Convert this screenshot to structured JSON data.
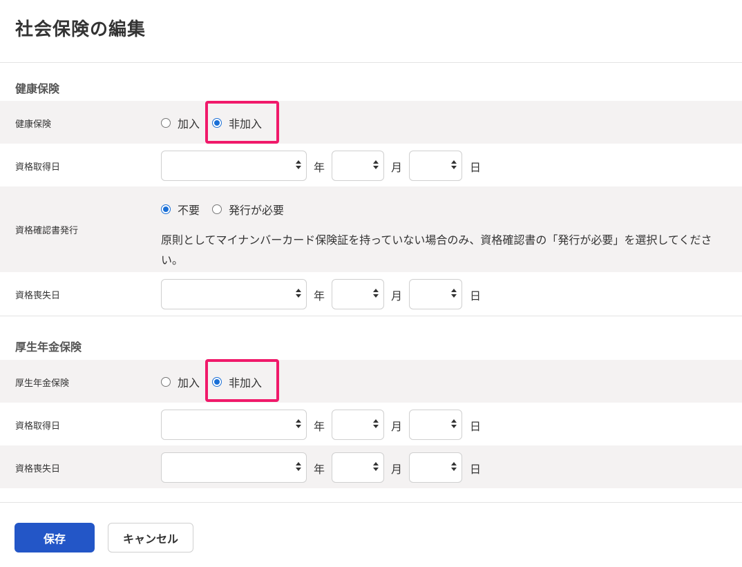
{
  "page": {
    "title": "社会保険の編集"
  },
  "health": {
    "section_title": "健康保険",
    "enrollment": {
      "label": "健康保険",
      "options": [
        {
          "label": "加入",
          "checked": false
        },
        {
          "label": "非加入",
          "checked": true
        }
      ]
    },
    "acquisition_date": {
      "label": "資格取得日",
      "year_unit": "年",
      "month_unit": "月",
      "day_unit": "日"
    },
    "certificate": {
      "label": "資格確認書発行",
      "options": [
        {
          "label": "不要",
          "checked": true
        },
        {
          "label": "発行が必要",
          "checked": false
        }
      ],
      "note": "原則としてマイナンバーカード保険証を持っていない場合のみ、資格確認書の「発行が必要」を選択してください。"
    },
    "loss_date": {
      "label": "資格喪失日",
      "year_unit": "年",
      "month_unit": "月",
      "day_unit": "日"
    }
  },
  "pension": {
    "section_title": "厚生年金保険",
    "enrollment": {
      "label": "厚生年金保険",
      "options": [
        {
          "label": "加入",
          "checked": false
        },
        {
          "label": "非加入",
          "checked": true
        }
      ]
    },
    "acquisition_date": {
      "label": "資格取得日",
      "year_unit": "年",
      "month_unit": "月",
      "day_unit": "日"
    },
    "loss_date": {
      "label": "資格喪失日",
      "year_unit": "年",
      "month_unit": "月",
      "day_unit": "日"
    }
  },
  "actions": {
    "save_label": "保存",
    "cancel_label": "キャンセル"
  },
  "colors": {
    "accent": "#2356c7",
    "radio": "#1a6fd6",
    "highlight": "#f0196a",
    "row_shade": "#f4f2f2"
  }
}
